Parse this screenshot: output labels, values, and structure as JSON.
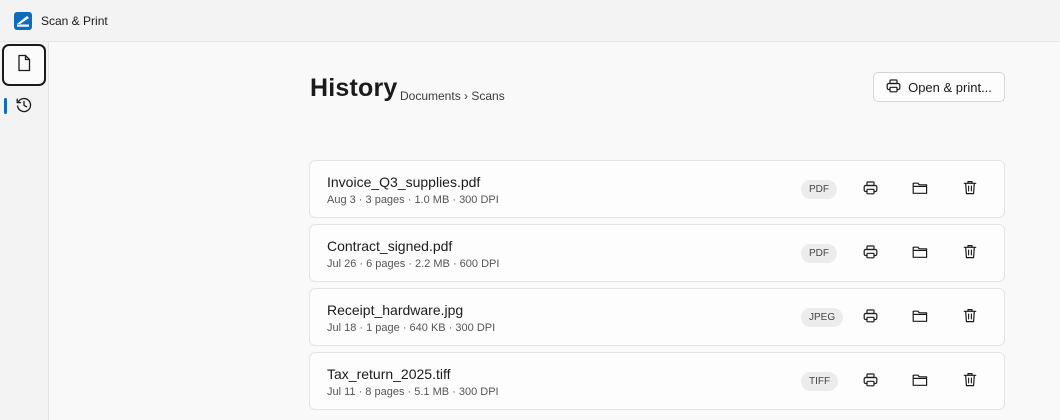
{
  "app": {
    "title": "Scan & Print",
    "icon": "scanner-app-icon",
    "accent": "#0f6cbd"
  },
  "nav": {
    "items": [
      {
        "name": "documents",
        "icon": "document-icon",
        "selected": true
      },
      {
        "name": "history",
        "icon": "history-icon",
        "selected": false
      }
    ]
  },
  "header": {
    "title": "History",
    "breadcrumb": "Documents › Scans",
    "open_print_label": "Open & print..."
  },
  "files": [
    {
      "name": "Invoice_Q3_supplies.pdf",
      "meta": "Aug 3 · 3 pages · 1.0 MB · 300 DPI",
      "type": "PDF"
    },
    {
      "name": "Contract_signed.pdf",
      "meta": "Jul 26 · 6 pages · 2.2 MB · 600 DPI",
      "type": "PDF"
    },
    {
      "name": "Receipt_hardware.jpg",
      "meta": "Jul 18 · 1 page · 640 KB · 300 DPI",
      "type": "JPEG"
    },
    {
      "name": "Tax_return_2025.tiff",
      "meta": "Jul 11 · 8 pages · 5.1 MB · 300 DPI",
      "type": "TIFF"
    }
  ],
  "row_actions": [
    "printer-icon",
    "folder-icon",
    "trash-icon"
  ]
}
